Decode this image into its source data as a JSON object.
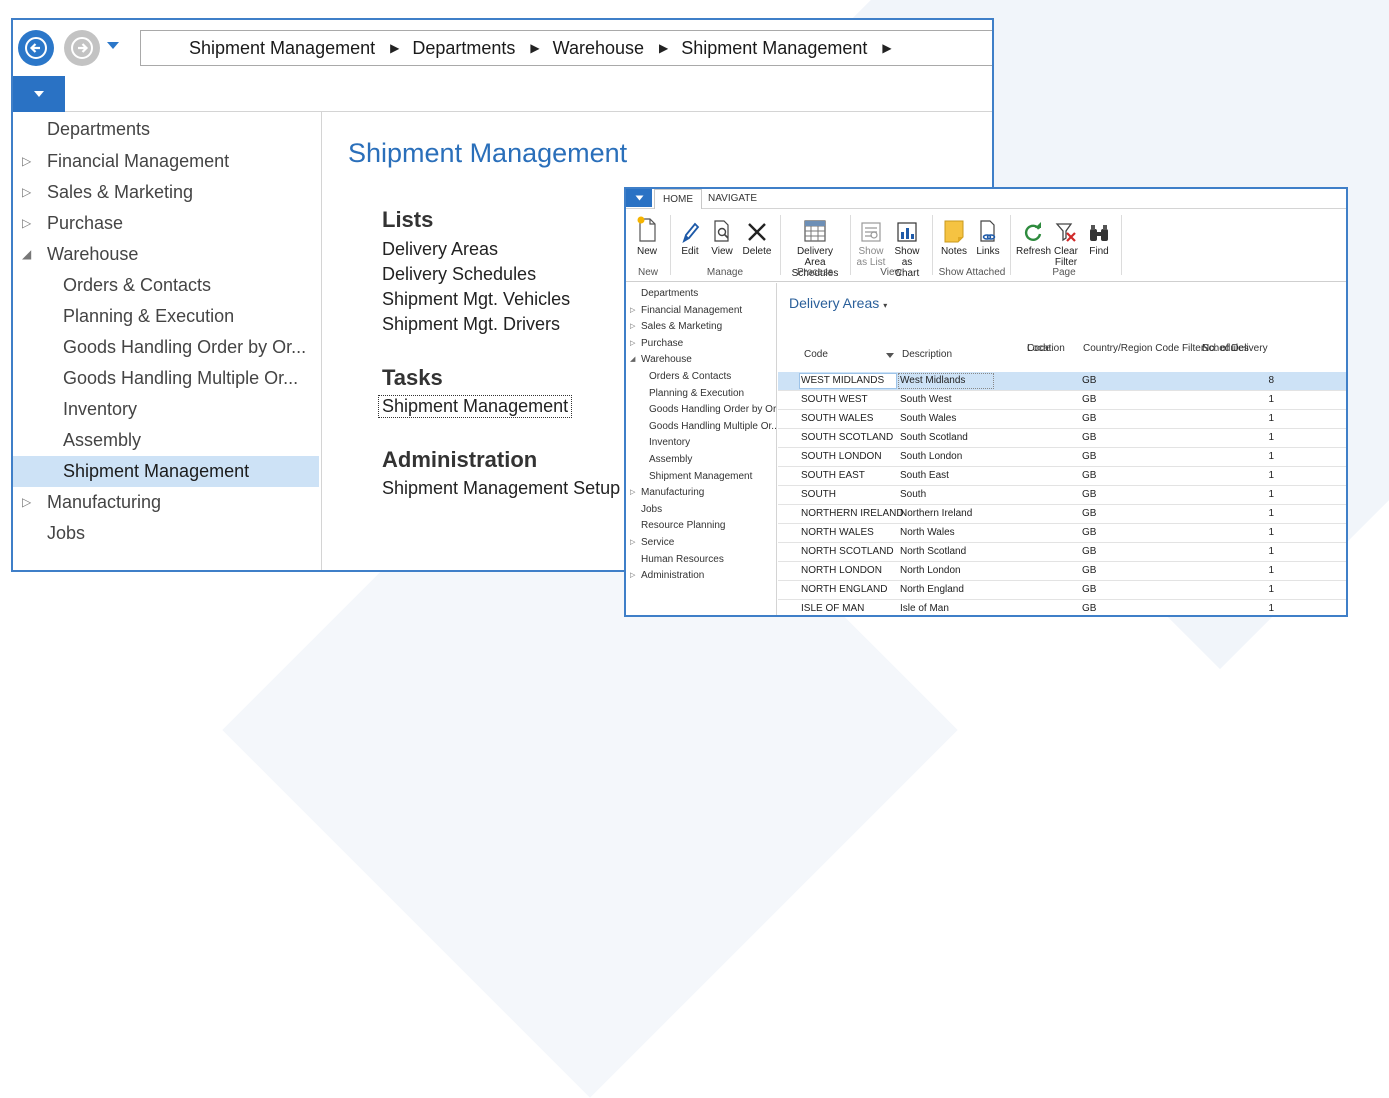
{
  "window1": {
    "breadcrumb": [
      "Shipment Management",
      "Departments",
      "Warehouse",
      "Shipment Management"
    ],
    "nav": [
      {
        "label": "Departments",
        "level": 0,
        "arrow": ""
      },
      {
        "label": "Financial Management",
        "level": 0,
        "arrow": "▷"
      },
      {
        "label": "Sales & Marketing",
        "level": 0,
        "arrow": "▷"
      },
      {
        "label": "Purchase",
        "level": 0,
        "arrow": "▷"
      },
      {
        "label": "Warehouse",
        "level": 0,
        "arrow": "◢"
      },
      {
        "label": "Orders & Contacts",
        "level": 1
      },
      {
        "label": "Planning & Execution",
        "level": 1
      },
      {
        "label": "Goods Handling Order by Or...",
        "level": 1
      },
      {
        "label": "Goods Handling Multiple Or...",
        "level": 1
      },
      {
        "label": "Inventory",
        "level": 1
      },
      {
        "label": "Assembly",
        "level": 1
      },
      {
        "label": "Shipment Management",
        "level": 1,
        "selected": true
      },
      {
        "label": "Manufacturing",
        "level": 0,
        "arrow": "▷"
      },
      {
        "label": "Jobs",
        "level": 0,
        "arrow": ""
      }
    ],
    "title": "Shipment Management",
    "lists_heading": "Lists",
    "lists": [
      "Delivery Areas",
      "Delivery Schedules",
      "Shipment Mgt. Vehicles",
      "Shipment Mgt. Drivers"
    ],
    "tasks_heading": "Tasks",
    "tasks": [
      "Shipment Management"
    ],
    "admin_heading": "Administration",
    "admin": [
      "Shipment Management Setup"
    ]
  },
  "window2": {
    "tabs": [
      "HOME",
      "NAVIGATE"
    ],
    "ribbon": {
      "new": "New",
      "edit": "Edit",
      "view": "View",
      "delete": "Delete",
      "delivery_area_schedules_1": "Delivery Area",
      "delivery_area_schedules_2": "Schedules",
      "show_as_list_1": "Show",
      "show_as_list_2": "as List",
      "show_as_chart_1": "Show as",
      "show_as_chart_2": "Chart",
      "notes": "Notes",
      "links": "Links",
      "refresh": "Refresh",
      "clear_filter_1": "Clear",
      "clear_filter_2": "Filter",
      "find": "Find",
      "groups": {
        "new": "New",
        "manage": "Manage",
        "process": "Process",
        "view": "View",
        "show_attached": "Show Attached",
        "page": "Page"
      }
    },
    "nav": [
      {
        "label": "Departments",
        "level": 0,
        "arrow": ""
      },
      {
        "label": "Financial Management",
        "level": 0,
        "arrow": "▷"
      },
      {
        "label": "Sales & Marketing",
        "level": 0,
        "arrow": "▷"
      },
      {
        "label": "Purchase",
        "level": 0,
        "arrow": "▷"
      },
      {
        "label": "Warehouse",
        "level": 0,
        "arrow": "◢"
      },
      {
        "label": "Orders & Contacts",
        "level": 1
      },
      {
        "label": "Planning & Execution",
        "level": 1
      },
      {
        "label": "Goods Handling Order by Or...",
        "level": 1
      },
      {
        "label": "Goods Handling Multiple Or...",
        "level": 1
      },
      {
        "label": "Inventory",
        "level": 1
      },
      {
        "label": "Assembly",
        "level": 1
      },
      {
        "label": "Shipment Management",
        "level": 1
      },
      {
        "label": "Manufacturing",
        "level": 0,
        "arrow": "▷"
      },
      {
        "label": "Jobs",
        "level": 0,
        "arrow": ""
      },
      {
        "label": "Resource Planning",
        "level": 0,
        "arrow": ""
      },
      {
        "label": "Service",
        "level": 0,
        "arrow": "▷"
      },
      {
        "label": "Human Resources",
        "level": 0,
        "arrow": ""
      },
      {
        "label": "Administration",
        "level": 0,
        "arrow": "▷"
      }
    ],
    "page_title": "Delivery Areas",
    "columns": {
      "code": "Code",
      "description": "Description",
      "location_code_1": "Location",
      "location_code_2": "Code",
      "country_filter": "Country/Region Code Filter",
      "no_schedules_1": "No. of Delivery",
      "no_schedules_2": "Schedules"
    },
    "rows": [
      {
        "code": "WEST MIDLANDS",
        "description": "West Midlands",
        "country": "GB",
        "count": "8",
        "selected": true
      },
      {
        "code": "SOUTH WEST",
        "description": "South West",
        "country": "GB",
        "count": "1"
      },
      {
        "code": "SOUTH WALES",
        "description": "South Wales",
        "country": "GB",
        "count": "1"
      },
      {
        "code": "SOUTH SCOTLAND",
        "description": "South Scotland",
        "country": "GB",
        "count": "1"
      },
      {
        "code": "SOUTH LONDON",
        "description": "South London",
        "country": "GB",
        "count": "1"
      },
      {
        "code": "SOUTH EAST",
        "description": "South East",
        "country": "GB",
        "count": "1"
      },
      {
        "code": "SOUTH",
        "description": "South",
        "country": "GB",
        "count": "1"
      },
      {
        "code": "NORTHERN IRELAND",
        "description": "Northern Ireland",
        "country": "GB",
        "count": "1"
      },
      {
        "code": "NORTH WALES",
        "description": "North Wales",
        "country": "GB",
        "count": "1"
      },
      {
        "code": "NORTH SCOTLAND",
        "description": "North Scotland",
        "country": "GB",
        "count": "1"
      },
      {
        "code": "NORTH LONDON",
        "description": "North London",
        "country": "GB",
        "count": "1"
      },
      {
        "code": "NORTH ENGLAND",
        "description": "North England",
        "country": "GB",
        "count": "1"
      },
      {
        "code": "ISLE OF MAN",
        "description": "Isle of Man",
        "country": "GB",
        "count": "1"
      }
    ]
  },
  "colors": {
    "accent": "#2a72c4",
    "selection": "#cde2f6",
    "title": "#2a6fba"
  }
}
